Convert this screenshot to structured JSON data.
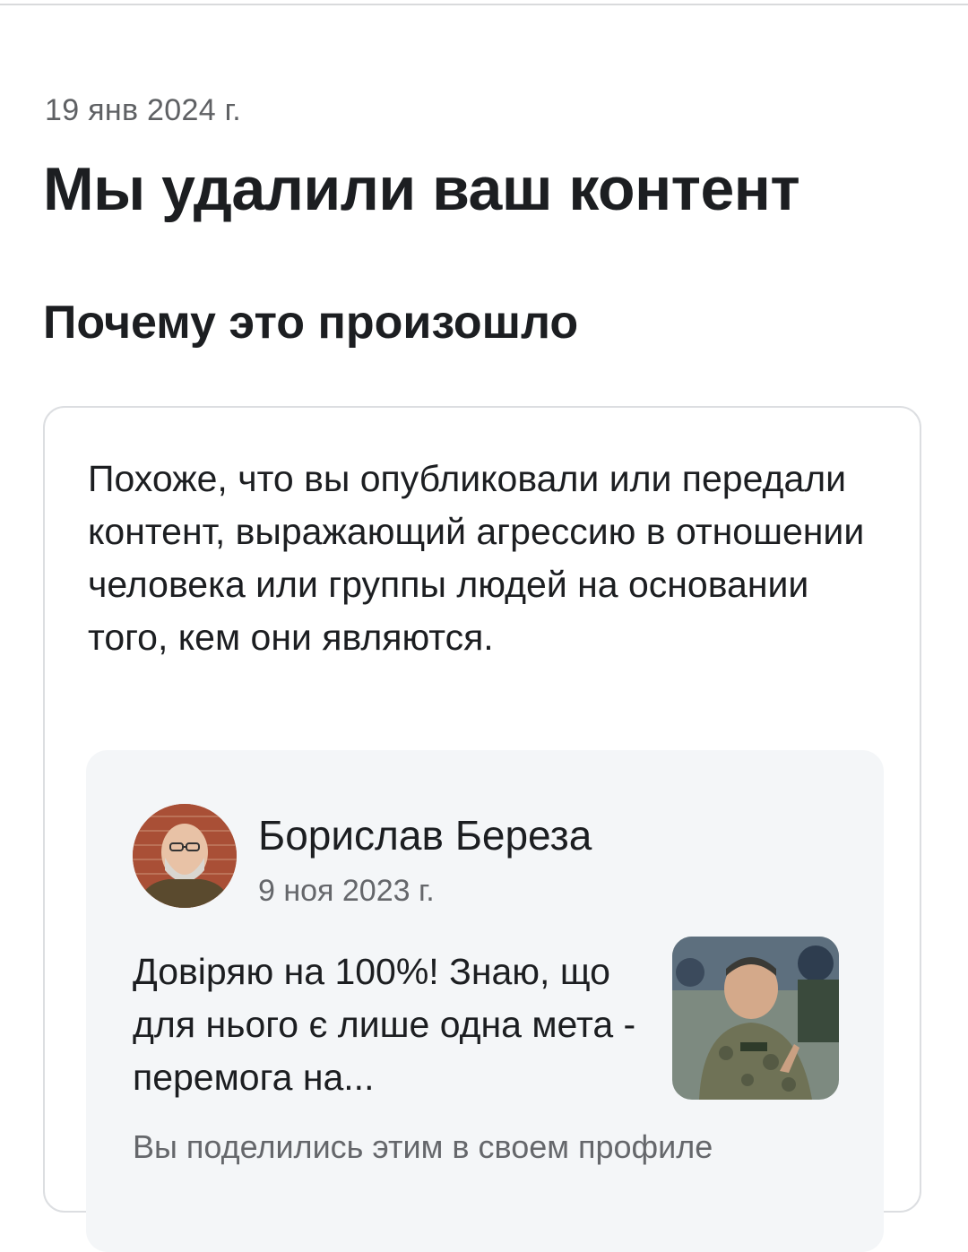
{
  "notice": {
    "date": "19 янв 2024 г.",
    "title": "Мы удалили ваш контент",
    "section_title": "Почему это произошло"
  },
  "reason": {
    "text": "Похоже, что вы опубликовали или передали контент, выражающий агрессию в отношении человека или группы людей на основании того, кем они являются."
  },
  "post": {
    "author": "Борислав Береза",
    "date": "9 ноя 2023 г.",
    "text": "Довіряю на 100%! Знаю, що для нього є лише одна мета - перемога на...",
    "shared_note": "Вы поделились этим в своем профиле",
    "avatar_icon": "person-avatar-photo",
    "thumbnail_icon": "post-photo-thumbnail"
  },
  "colors": {
    "text_primary": "#1c1e21",
    "text_secondary": "#65676b",
    "card_border": "#dcdee1",
    "post_background": "#f4f6f8"
  }
}
